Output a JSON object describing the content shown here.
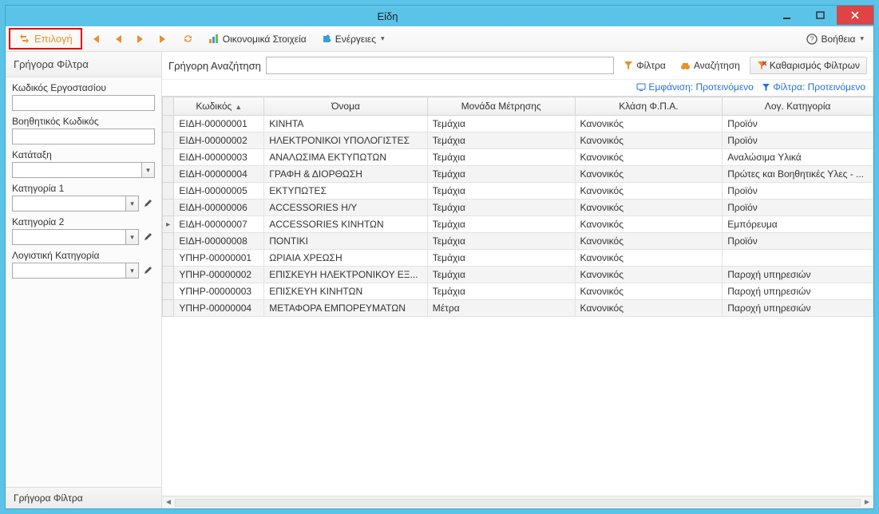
{
  "window": {
    "title": "Είδη"
  },
  "toolbar": {
    "select_label": "Επιλογή",
    "economic_label": "Οικονομικά Στοιχεία",
    "actions_label": "Ενέργειες",
    "help_label": "Βοήθεια"
  },
  "sidebar": {
    "header": "Γρήγορα Φίλτρα",
    "footer": "Γρήγορα Φίλτρα",
    "filters": [
      {
        "label": "Κωδικός Εργοστασίου",
        "type": "text"
      },
      {
        "label": "Βοηθητικός Κωδικός",
        "type": "text"
      },
      {
        "label": "Κατάταξη",
        "type": "combo"
      },
      {
        "label": "Κατηγορία 1",
        "type": "combo_pencil"
      },
      {
        "label": "Κατηγορία 2",
        "type": "combo_pencil"
      },
      {
        "label": "Λογιστική Κατηγορία",
        "type": "combo_pencil"
      }
    ]
  },
  "search": {
    "label": "Γρήγορη Αναζήτηση",
    "filters_btn": "Φίλτρα",
    "search_btn": "Αναζήτηση",
    "clear_btn": "Καθαρισμός Φίλτρων"
  },
  "viewbar": {
    "view_label": "Εμφάνιση:",
    "view_value": "Προτεινόμενο",
    "filter_label": "Φίλτρα:",
    "filter_value": "Προτεινόμενο"
  },
  "grid": {
    "columns": [
      "Κωδικός",
      "Όνομα",
      "Μονάδα Μέτρησης",
      "Κλάση Φ.Π.Α.",
      "Λογ. Κατηγορία"
    ],
    "sort_col": 0,
    "active_row": 6,
    "rows": [
      [
        "ΕΙΔΗ-00000001",
        "ΚΙΝΗΤΑ",
        "Τεμάχια",
        "Κανονικός",
        "Προϊόν"
      ],
      [
        "ΕΙΔΗ-00000002",
        "ΗΛΕΚΤΡΟΝΙΚΟΙ ΥΠΟΛΟΓΙΣΤΕΣ",
        "Τεμάχια",
        "Κανονικός",
        "Προϊόν"
      ],
      [
        "ΕΙΔΗ-00000003",
        "ΑΝΑΛΩΣΙΜΑ ΕΚΤΥΠΩΤΩΝ",
        "Τεμάχια",
        "Κανονικός",
        "Αναλώσιμα Υλικά"
      ],
      [
        "ΕΙΔΗ-00000004",
        "ΓΡΑΦΗ & ΔΙΟΡΘΩΣΗ",
        "Τεμάχια",
        "Κανονικός",
        "Πρώτες και Βοηθητικές Υλες - ..."
      ],
      [
        "ΕΙΔΗ-00000005",
        "ΕΚΤΥΠΩΤΕΣ",
        "Τεμάχια",
        "Κανονικός",
        "Προϊόν"
      ],
      [
        "ΕΙΔΗ-00000006",
        "ACCESSORIES H/Y",
        "Τεμάχια",
        "Κανονικός",
        "Προϊόν"
      ],
      [
        "ΕΙΔΗ-00000007",
        "ACCESSORIES ΚΙΝΗΤΩΝ",
        "Τεμάχια",
        "Κανονικός",
        "Εμπόρευμα"
      ],
      [
        "ΕΙΔΗ-00000008",
        "ΠΟΝΤΙΚΙ",
        "Τεμάχια",
        "Κανονικός",
        "Προϊόν"
      ],
      [
        "ΥΠΗΡ-00000001",
        "ΩΡΙΑΙΑ ΧΡΕΩΣΗ",
        "Τεμάχια",
        "Κανονικός",
        ""
      ],
      [
        "ΥΠΗΡ-00000002",
        "ΕΠΙΣΚΕΥΗ ΗΛΕΚΤΡΟΝΙΚΟΥ ΕΞ...",
        "Τεμάχια",
        "Κανονικός",
        "Παροχή υπηρεσιών"
      ],
      [
        "ΥΠΗΡ-00000003",
        "ΕΠΙΣΚΕΥΗ ΚΙΝΗΤΩΝ",
        "Τεμάχια",
        "Κανονικός",
        "Παροχή υπηρεσιών"
      ],
      [
        "ΥΠΗΡ-00000004",
        "ΜΕΤΑΦΟΡΑ ΕΜΠΟΡΕΥΜΑΤΩΝ",
        "Μέτρα",
        "Κανονικός",
        "Παροχή υπηρεσιών"
      ]
    ]
  }
}
